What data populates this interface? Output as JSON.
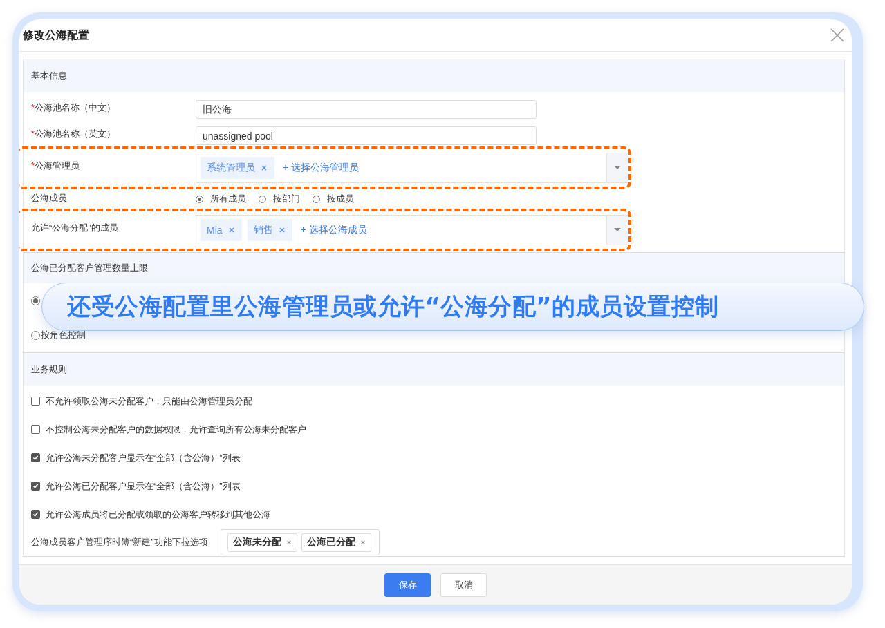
{
  "dialog": {
    "title": "修改公海配置"
  },
  "sections": [
    {
      "kind": "form",
      "title": "基本信息",
      "fields": [
        {
          "kind": "text",
          "required_mark": "*",
          "label": "公海池名称（中文）",
          "value": "旧公海",
          "highlighted": false
        },
        {
          "kind": "text",
          "required_mark": "*",
          "label": "公海池名称（英文）",
          "value": "unassigned pool",
          "highlighted": false
        },
        {
          "kind": "multiselect",
          "required_mark": "*",
          "label": "公海管理员",
          "tags": [
            "系统管理员"
          ],
          "add_link": "+ 选择公海管理员",
          "highlighted": true
        },
        {
          "kind": "radio",
          "label": "公海成员",
          "options": [
            {
              "label": "所有成员",
              "selected": true
            },
            {
              "label": "按部门",
              "selected": false
            },
            {
              "label": "按成员",
              "selected": false
            }
          ],
          "highlighted": false
        },
        {
          "kind": "multiselect",
          "label": "允许“公海分配”的成员",
          "tags": [
            "Mia",
            "销售"
          ],
          "add_link": "+ 选择公海成员",
          "highlighted": true
        }
      ]
    },
    {
      "kind": "radio_list",
      "title": "公海已分配客户管理数量上限",
      "options": [
        {
          "selected": true
        },
        {
          "label": "按角色控制",
          "selected": false
        }
      ]
    },
    {
      "kind": "rules",
      "title": "业务规则",
      "rules": [
        {
          "label": "不允许领取公海未分配客户，只能由公海管理员分配",
          "checked": false
        },
        {
          "label": "不控制公海未分配客户的数据权限，允许查询所有公海未分配客户",
          "checked": false
        },
        {
          "label": "允许公海未分配客户显示在“全部（含公海）”列表",
          "checked": true
        },
        {
          "label": "允许公海已分配客户显示在“全部（含公海）”列表",
          "checked": true
        },
        {
          "label": "允许公海成员将已分配或领取的公海客户转移到其他公海",
          "checked": true
        }
      ],
      "dropdown_options": {
        "label": "公海成员客户管理序时簿“新建”功能下拉选项",
        "tags": [
          "公海未分配",
          "公海已分配"
        ]
      }
    }
  ],
  "buttons": [
    {
      "label": "保存",
      "kind": "primary"
    },
    {
      "label": "取消",
      "kind": "default"
    }
  ],
  "callout": "还受公海配置里公海管理员或允许“公海分配”的成员设置控制"
}
